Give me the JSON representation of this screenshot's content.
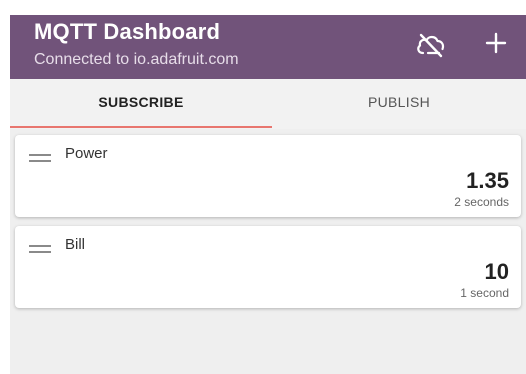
{
  "header": {
    "title": "MQTT Dashboard",
    "subtitle": "Connected to io.adafruit.com",
    "cloud_icon": "cloud-off-icon",
    "add_icon": "plus-icon"
  },
  "tabs": [
    {
      "label": "SUBSCRIBE",
      "active": true
    },
    {
      "label": "PUBLISH",
      "active": false
    }
  ],
  "subscriptions": [
    {
      "name": "Power",
      "value": "1.35",
      "updated": "2 seconds"
    },
    {
      "name": "Bill",
      "value": "10",
      "updated": "1 second"
    }
  ],
  "colors": {
    "app_bar": "#71537a",
    "tab_indicator": "#e8766f",
    "content_background": "#efefef"
  }
}
